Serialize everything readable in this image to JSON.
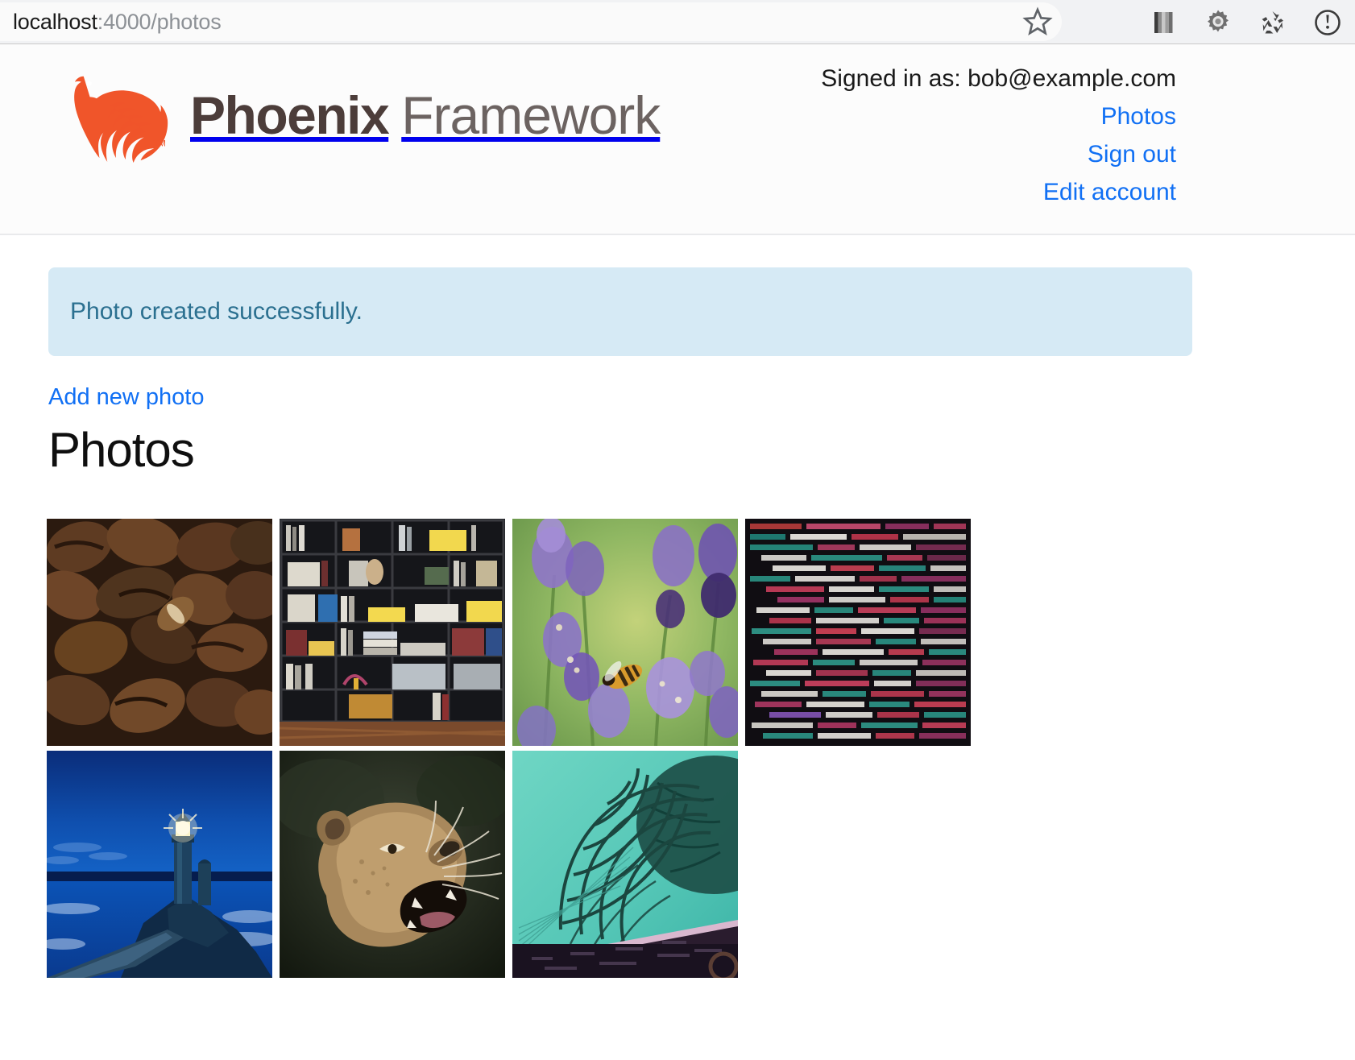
{
  "browser": {
    "url_host": "localhost",
    "url_path": ":4000/photos",
    "icons": [
      {
        "name": "bookmark-star-icon",
        "label": "Bookmark"
      },
      {
        "name": "grayscale-bar-icon",
        "label": "Color bars"
      },
      {
        "name": "gear-icon",
        "label": "Settings"
      },
      {
        "name": "recycle-icon",
        "label": "Recycle"
      },
      {
        "name": "info-circle-icon",
        "label": "Info"
      }
    ]
  },
  "header": {
    "logo_primary": "Phoenix",
    "logo_secondary": "Framework",
    "signed_in_text": "Signed in as: bob@example.com",
    "nav": [
      {
        "label": "Photos",
        "name": "nav-photos"
      },
      {
        "label": "Sign out",
        "name": "nav-sign-out"
      },
      {
        "label": "Edit account",
        "name": "nav-edit-account"
      }
    ]
  },
  "main": {
    "flash_message": "Photo created successfully.",
    "add_new_photo_label": "Add new photo",
    "page_title": "Photos",
    "photos": [
      {
        "name": "photo-coffee-beans",
        "alt": "Roasted coffee beans"
      },
      {
        "name": "photo-bookshelf",
        "alt": "Dark bookshelf full of books"
      },
      {
        "name": "photo-lavender-bee",
        "alt": "Bee on lavender flowers"
      },
      {
        "name": "photo-source-code",
        "alt": "Blurred syntax highlighted source code"
      },
      {
        "name": "photo-lighthouse",
        "alt": "Lighthouse at blue hour"
      },
      {
        "name": "photo-lioness",
        "alt": "Roaring lioness"
      },
      {
        "name": "photo-supertrees",
        "alt": "Gardens by the Bay supertree structures"
      }
    ]
  },
  "colors": {
    "link": "#1170f4",
    "flash_bg": "#d6eaf5",
    "flash_text": "#2b7090",
    "logo_orange": "#f0552a",
    "logo_dark": "#4c3d3a"
  }
}
